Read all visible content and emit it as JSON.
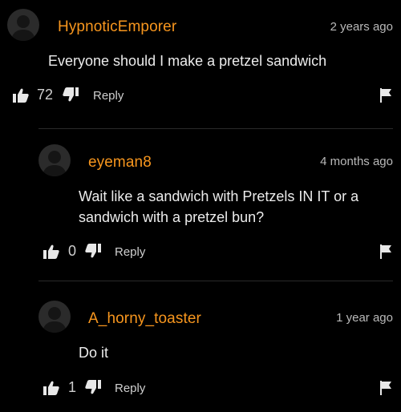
{
  "comments": [
    {
      "username": "HypnoticEmporer",
      "time": "2 years ago",
      "text": "Everyone should I make a pretzel sandwich",
      "likes": "72",
      "reply_label": "Reply"
    },
    {
      "username": "eyeman8",
      "time": "4 months ago",
      "text_line1": "Wait like a sandwich with Pretzels IN IT or a",
      "text_line2": "sandwich with a pretzel bun?",
      "likes": "0",
      "reply_label": "Reply"
    },
    {
      "username": "A_horny_toaster",
      "time": "1 year ago",
      "text": "Do it",
      "likes": "1",
      "reply_label": "Reply"
    }
  ],
  "colors": {
    "username": "#f7961e",
    "background": "#000000",
    "text": "#ececec",
    "muted": "#b9b9b9"
  },
  "icons": [
    "avatar-placeholder",
    "thumbs-up-icon",
    "thumbs-down-icon",
    "flag-icon"
  ]
}
